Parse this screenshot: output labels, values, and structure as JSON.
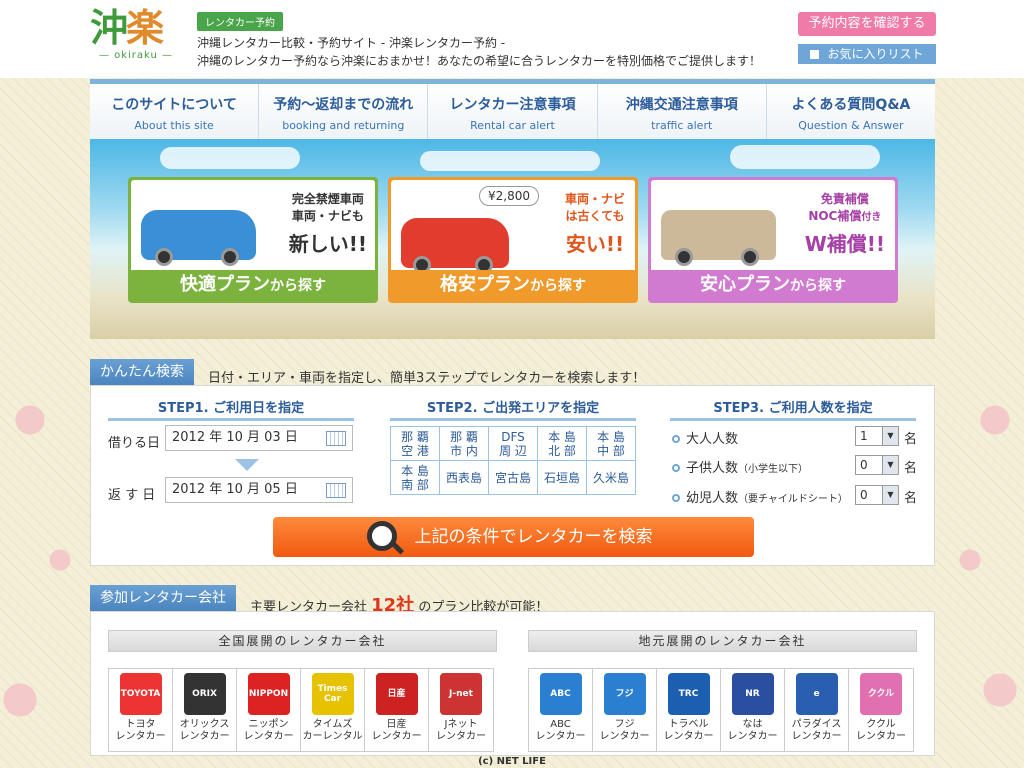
{
  "header": {
    "logo_kanji_1": "沖",
    "logo_kanji_2": "楽",
    "logo_roman": "— okiraku —",
    "badge": "レンタカー予約",
    "tagline_1": "沖縄レンタカー比較・予約サイト - 沖楽レンタカー予約 -",
    "tagline_2": "沖縄のレンタカー予約なら沖楽におまかせ！あなたの希望に合うレンタカーを特別価格でご提供します！",
    "confirm_button": "予約内容を確認する",
    "favorites_button": "お気に入りリスト"
  },
  "nav": [
    {
      "jp": "このサイトについて",
      "en": "About this site"
    },
    {
      "jp": "予約～返却までの流れ",
      "en": "booking and returning"
    },
    {
      "jp": "レンタカー注意事項",
      "en": "Rental car alert"
    },
    {
      "jp": "沖縄交通注意事項",
      "en": "traffic alert"
    },
    {
      "jp": "よくある質問Q&A",
      "en": "Question & Answer"
    }
  ],
  "plans": [
    {
      "line1": "完全禁煙車両",
      "line2": "車両・ナビも",
      "line3": "新しい!!",
      "button": "快適プラン",
      "button_suffix": "から探す",
      "color": "#7cb33e"
    },
    {
      "price": "¥2,800",
      "line1": "車両・ナビ",
      "line2": "は古くても",
      "line3": "安い!!",
      "button": "格安プラン",
      "button_suffix": "から探す",
      "color": "#ef9a2a"
    },
    {
      "line1": "免責補償",
      "line2": "NOC補償",
      "line2_suffix": "付き",
      "line3": "W補償!!",
      "button": "安心プラン",
      "button_suffix": "から探す",
      "color": "#d07bd0"
    }
  ],
  "search": {
    "label": "かんたん検索",
    "desc": "日付・エリア・車両を指定し、簡単3ステップでレンタカーを検索します！",
    "step1": "STEP1. ご利用日を指定",
    "step2": "STEP2. ご出発エリアを指定",
    "step3": "STEP3. ご利用人数を指定",
    "pickup_label": "借りる日",
    "pickup_value": "2012 年 10 月 03 日",
    "return_label": "返 す 日",
    "return_value": "2012 年 10 月 05 日",
    "areas_row1": [
      "那 覇\n空 港",
      "那 覇\n市 内",
      "DFS\n周 辺",
      "本 島\n北 部",
      "本 島\n中 部"
    ],
    "areas_row2": [
      "本 島\n南 部",
      "西表島",
      "宮古島",
      "石垣島",
      "久米島"
    ],
    "adults_label": "大人人数",
    "adults_value": "1",
    "children_label": "子供人数",
    "children_note": "（小学生以下）",
    "children_value": "0",
    "infants_label": "幼児人数",
    "infants_note": "（要チャイルドシート）",
    "infants_value": "0",
    "unit": "名",
    "search_button": "上記の条件でレンタカーを検索"
  },
  "companies": {
    "label": "参加レンタカー会社",
    "desc_pre": "主要レンタカー会社",
    "desc_count": "12社",
    "desc_post": "のプラン比較が可能！",
    "national_heading": "全国展開のレンタカー会社",
    "local_heading": "地元展開のレンタカー会社",
    "national": [
      {
        "name": "トヨタ\nレンタカー",
        "logo": "TOYOTA",
        "color": "#e33"
      },
      {
        "name": "オリックス\nレンタカー",
        "logo": "ORIX",
        "color": "#333"
      },
      {
        "name": "ニッポン\nレンタカー",
        "logo": "NIPPON",
        "color": "#d22"
      },
      {
        "name": "タイムズ\nカーレンタル",
        "logo": "Times Car",
        "color": "#e6c200"
      },
      {
        "name": "日産\nレンタカー",
        "logo": "日産",
        "color": "#c22"
      },
      {
        "name": "Jネット\nレンタカー",
        "logo": "J-net",
        "color": "#c33"
      }
    ],
    "local": [
      {
        "name": "ABC\nレンタカー",
        "logo": "ABC",
        "color": "#2a7fd0"
      },
      {
        "name": "フジ\nレンタカー",
        "logo": "フジ",
        "color": "#2a7fd0"
      },
      {
        "name": "トラベル\nレンタカー",
        "logo": "TRC",
        "color": "#1b5fb0"
      },
      {
        "name": "なは\nレンタカー",
        "logo": "NR",
        "color": "#2a4fa0"
      },
      {
        "name": "パラダイス\nレンタカー",
        "logo": "e",
        "color": "#2a5fb0"
      },
      {
        "name": "ククル\nレンタカー",
        "logo": "ククル",
        "color": "#e070b0"
      }
    ]
  },
  "footer": {
    "copyright": "(c) NET LIFE"
  }
}
